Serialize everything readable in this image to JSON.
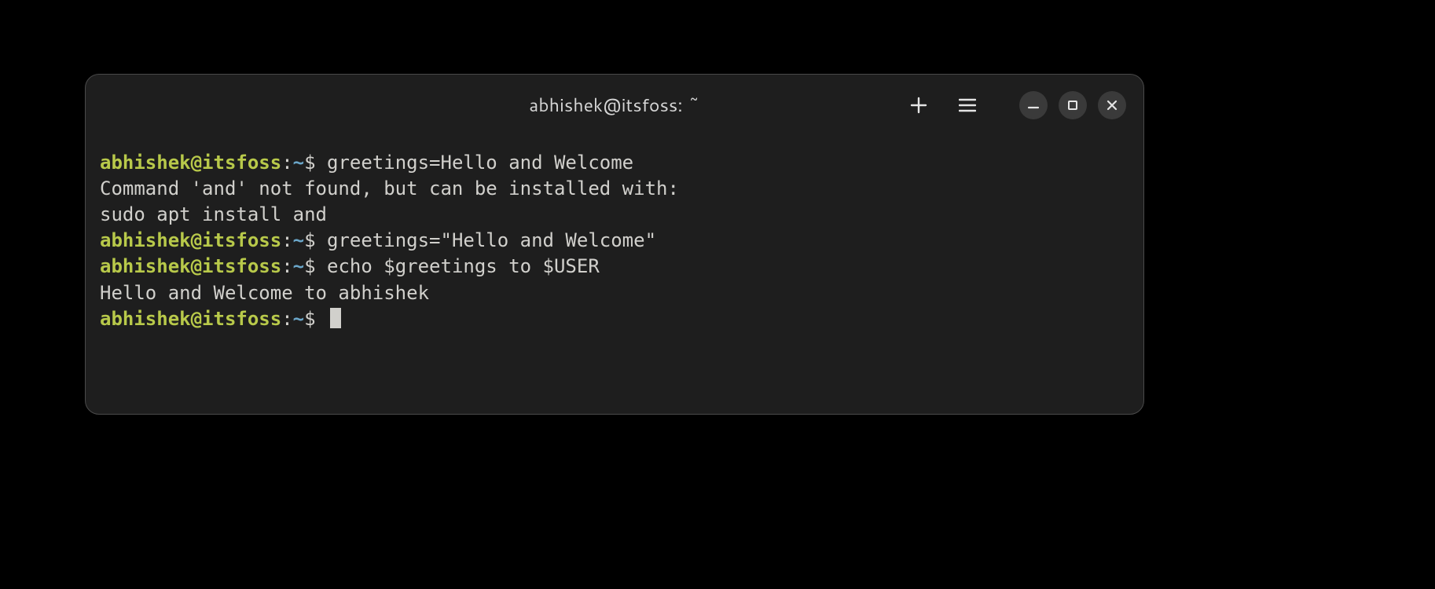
{
  "window": {
    "title": "abhishek@itsfoss: ~"
  },
  "prompt": {
    "user_host": "abhishek@itsfoss",
    "colon": ":",
    "path": "~",
    "symbol": "$"
  },
  "lines": [
    {
      "type": "cmd",
      "text": "greetings=Hello and Welcome"
    },
    {
      "type": "output",
      "text": "Command 'and' not found, but can be installed with:"
    },
    {
      "type": "output",
      "text": "sudo apt install and"
    },
    {
      "type": "cmd",
      "text": "greetings=\"Hello and Welcome\""
    },
    {
      "type": "cmd",
      "text": "echo $greetings to $USER"
    },
    {
      "type": "output",
      "text": "Hello and Welcome to abhishek"
    },
    {
      "type": "prompt",
      "text": ""
    }
  ],
  "icons": {
    "new_tab": "plus",
    "menu": "hamburger",
    "minimize": "minimize",
    "maximize": "maximize",
    "close": "close"
  }
}
